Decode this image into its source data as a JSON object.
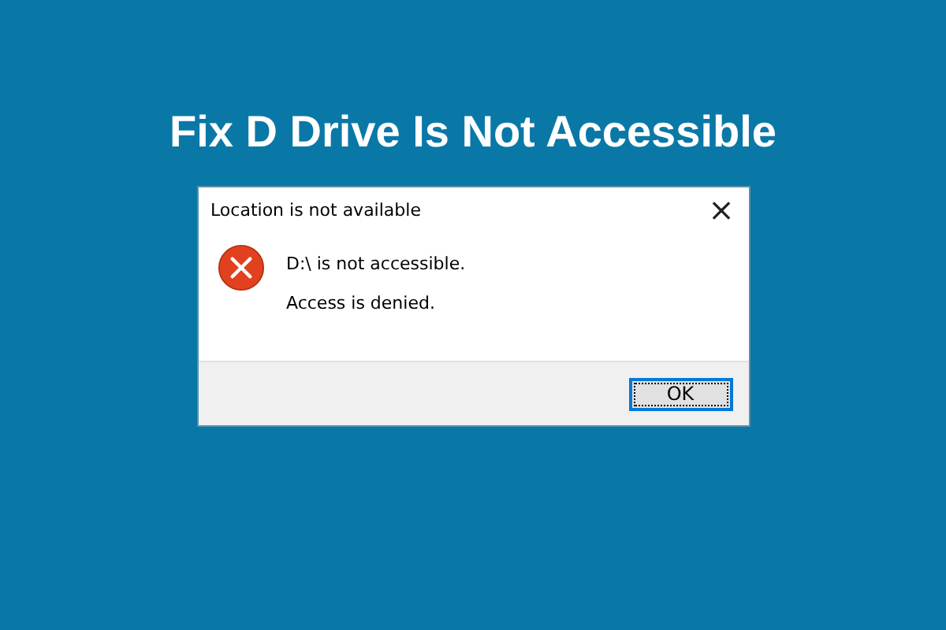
{
  "heading": "Fix D Drive Is Not Accessible",
  "dialog": {
    "title": "Location is not available",
    "close": "×",
    "kind": "error",
    "messages": [
      "D:\\ is not accessible.",
      "Access is denied."
    ],
    "buttons": [
      {
        "label": "OK",
        "focused": true
      }
    ]
  }
}
